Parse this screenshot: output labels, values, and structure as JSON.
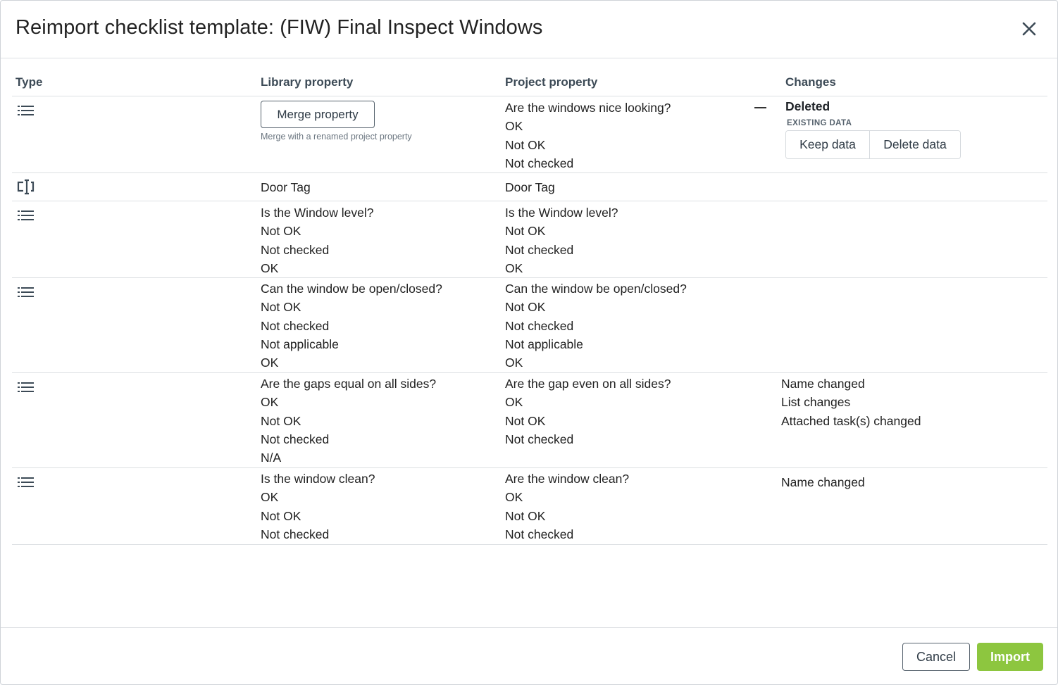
{
  "dialog": {
    "title": "Reimport checklist template: (FIW) Final Inspect Windows"
  },
  "columns": {
    "type": "Type",
    "library": "Library property",
    "project": "Project property",
    "changes": "Changes"
  },
  "rows": [
    {
      "type_icon": "list-icon",
      "merge_button": "Merge property",
      "merge_help": "Merge with a renamed project property",
      "project": [
        "Are the windows nice looking?",
        "OK",
        "Not OK",
        "Not checked"
      ],
      "change_status": "Deleted",
      "existing_data_label": "EXISTING DATA",
      "keep_button": "Keep data",
      "delete_button": "Delete data"
    },
    {
      "type_icon": "text-field-icon",
      "library": [
        "Door Tag"
      ],
      "project": [
        "Door Tag"
      ],
      "changes": []
    },
    {
      "type_icon": "list-icon",
      "library": [
        "Is the Window level?",
        "Not OK",
        "Not checked",
        "OK"
      ],
      "project": [
        "Is the Window level?",
        "Not OK",
        "Not checked",
        "OK"
      ],
      "changes": []
    },
    {
      "type_icon": "list-icon",
      "library": [
        "Can the window be open/closed?",
        "Not OK",
        "Not checked",
        "Not applicable",
        "OK"
      ],
      "project": [
        "Can the window be open/closed?",
        "Not OK",
        "Not checked",
        "Not applicable",
        "OK"
      ],
      "changes": []
    },
    {
      "type_icon": "list-icon",
      "library": [
        "Are the gaps equal on all sides?",
        "OK",
        "Not OK",
        "Not checked",
        "N/A"
      ],
      "project": [
        "Are the gap even on all sides?",
        "OK",
        "Not OK",
        "Not checked"
      ],
      "changes": [
        "Name changed",
        "List changes",
        "Attached task(s) changed"
      ]
    },
    {
      "type_icon": "list-icon",
      "library": [
        "Is the window clean?",
        "OK",
        "Not OK",
        "Not checked"
      ],
      "project": [
        "Are the window clean?",
        "OK",
        "Not OK",
        "Not checked"
      ],
      "changes": [
        "Name changed"
      ]
    }
  ],
  "footer": {
    "cancel": "Cancel",
    "import": "Import"
  },
  "colors": {
    "primary": "#8dc63f",
    "heading": "#3c4a56",
    "border": "#dde0e3"
  }
}
